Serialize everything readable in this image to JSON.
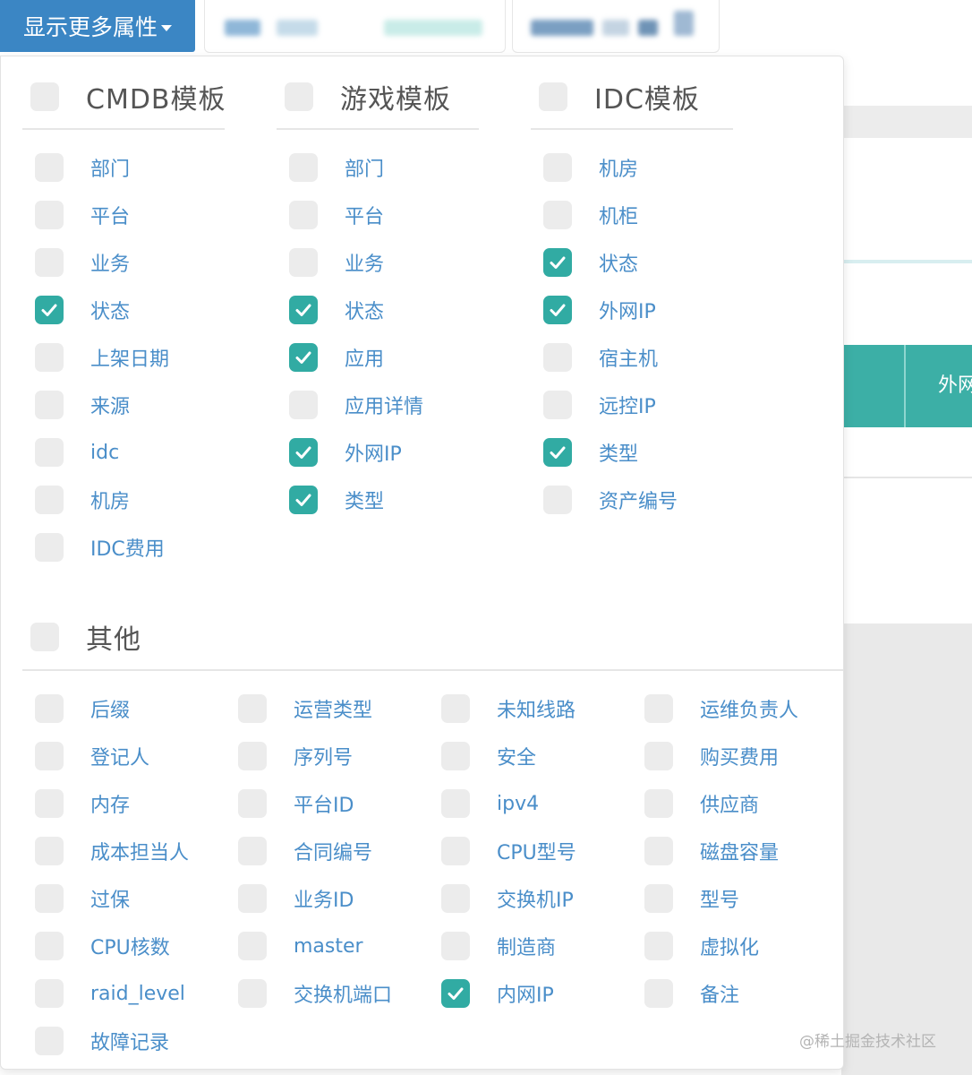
{
  "trigger": {
    "label": "显示更多属性"
  },
  "groups": {
    "cmdb": {
      "title": "CMDB模板",
      "items": [
        {
          "label": "部门",
          "checked": false
        },
        {
          "label": "平台",
          "checked": false
        },
        {
          "label": "业务",
          "checked": false
        },
        {
          "label": "状态",
          "checked": true
        },
        {
          "label": "上架日期",
          "checked": false
        },
        {
          "label": "来源",
          "checked": false
        },
        {
          "label": "idc",
          "checked": false
        },
        {
          "label": "机房",
          "checked": false
        },
        {
          "label": "IDC费用",
          "checked": false
        }
      ]
    },
    "game": {
      "title": "游戏模板",
      "items": [
        {
          "label": "部门",
          "checked": false
        },
        {
          "label": "平台",
          "checked": false
        },
        {
          "label": "业务",
          "checked": false
        },
        {
          "label": "状态",
          "checked": true
        },
        {
          "label": "应用",
          "checked": true
        },
        {
          "label": "应用详情",
          "checked": false
        },
        {
          "label": "外网IP",
          "checked": true
        },
        {
          "label": "类型",
          "checked": true
        }
      ]
    },
    "idc": {
      "title": "IDC模板",
      "items": [
        {
          "label": "机房",
          "checked": false
        },
        {
          "label": "机柜",
          "checked": false
        },
        {
          "label": "状态",
          "checked": true
        },
        {
          "label": "外网IP",
          "checked": true
        },
        {
          "label": "宿主机",
          "checked": false
        },
        {
          "label": "远控IP",
          "checked": false
        },
        {
          "label": "类型",
          "checked": true
        },
        {
          "label": "资产编号",
          "checked": false
        }
      ]
    },
    "other": {
      "title": "其他",
      "columns": [
        [
          {
            "label": "后缀",
            "checked": false
          },
          {
            "label": "登记人",
            "checked": false
          },
          {
            "label": "内存",
            "checked": false
          },
          {
            "label": "成本担当人",
            "checked": false
          },
          {
            "label": "过保",
            "checked": false
          },
          {
            "label": "CPU核数",
            "checked": false
          },
          {
            "label": "raid_level",
            "checked": false
          },
          {
            "label": "故障记录",
            "checked": false
          }
        ],
        [
          {
            "label": "运营类型",
            "checked": false
          },
          {
            "label": "序列号",
            "checked": false
          },
          {
            "label": "平台ID",
            "checked": false
          },
          {
            "label": "合同编号",
            "checked": false
          },
          {
            "label": "业务ID",
            "checked": false
          },
          {
            "label": "master",
            "checked": false
          },
          {
            "label": "交换机端口",
            "checked": false
          }
        ],
        [
          {
            "label": "未知线路",
            "checked": false
          },
          {
            "label": "安全",
            "checked": false
          },
          {
            "label": "ipv4",
            "checked": false
          },
          {
            "label": "CPU型号",
            "checked": false
          },
          {
            "label": "交换机IP",
            "checked": false
          },
          {
            "label": "制造商",
            "checked": false
          },
          {
            "label": "内网IP",
            "checked": true
          }
        ],
        [
          {
            "label": "运维负责人",
            "checked": false
          },
          {
            "label": "购买费用",
            "checked": false
          },
          {
            "label": "供应商",
            "checked": false
          },
          {
            "label": "磁盘容量",
            "checked": false
          },
          {
            "label": "型号",
            "checked": false
          },
          {
            "label": "虚拟化",
            "checked": false
          },
          {
            "label": "备注",
            "checked": false
          }
        ]
      ]
    }
  },
  "background": {
    "table_header_fragment": "外网"
  },
  "watermark": "@稀土掘金技术社区",
  "colors": {
    "accent": "#31aba3",
    "link": "#4a8ec9",
    "button": "#3b86c4",
    "checkbox_off": "#ececec"
  },
  "icons": {
    "check": "check-icon",
    "caret": "caret-down-icon"
  }
}
